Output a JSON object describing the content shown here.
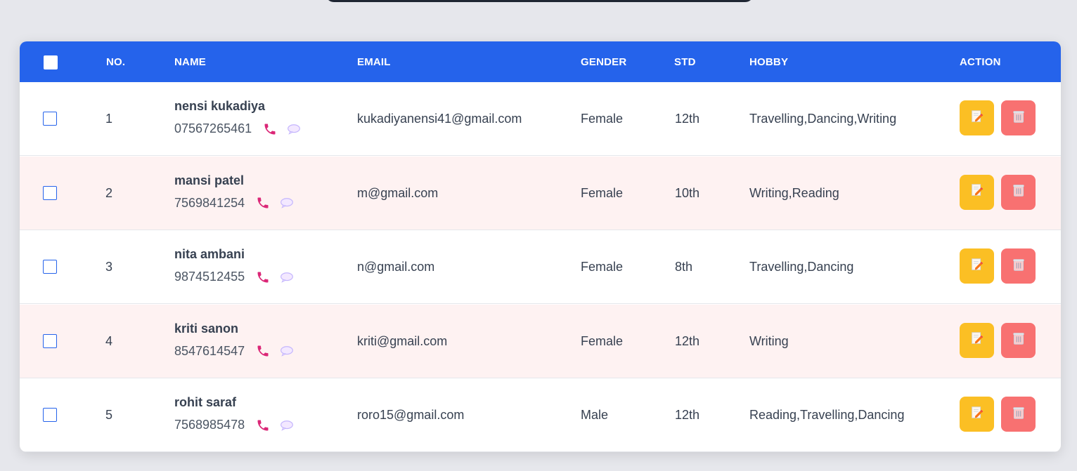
{
  "header": {
    "columns": [
      "NO.",
      "NAME",
      "EMAIL",
      "GENDER",
      "STD",
      "HOBBY",
      "ACTION"
    ]
  },
  "rows": [
    {
      "no": "1",
      "name": "nensi kukadiya",
      "phone": "07567265461",
      "email": "kukadiyanensi41@gmail.com",
      "gender": "Female",
      "std": "12th",
      "hobby": "Travelling,Dancing,Writing"
    },
    {
      "no": "2",
      "name": "mansi patel",
      "phone": "7569841254",
      "email": "m@gmail.com",
      "gender": "Female",
      "std": "10th",
      "hobby": "Writing,Reading"
    },
    {
      "no": "3",
      "name": "nita ambani",
      "phone": "9874512455",
      "email": "n@gmail.com",
      "gender": "Female",
      "std": "8th",
      "hobby": "Travelling,Dancing"
    },
    {
      "no": "4",
      "name": "kriti sanon",
      "phone": "8547614547",
      "email": "kriti@gmail.com",
      "gender": "Female",
      "std": "12th",
      "hobby": "Writing"
    },
    {
      "no": "5",
      "name": "rohit saraf",
      "phone": "7568985478",
      "email": "roro15@gmail.com",
      "gender": "Male",
      "std": "12th",
      "hobby": "Reading,Travelling,Dancing"
    }
  ],
  "icons": {
    "phone": "phone-icon",
    "chat": "chat-bubble-icon",
    "edit": "edit-pencil-icon",
    "delete": "trash-icon"
  },
  "colors": {
    "header": "#2563eb",
    "row_alt": "#fef2f2",
    "edit_button": "#fbbf24",
    "delete_button": "#f87171",
    "phone_icon": "#db2777"
  }
}
